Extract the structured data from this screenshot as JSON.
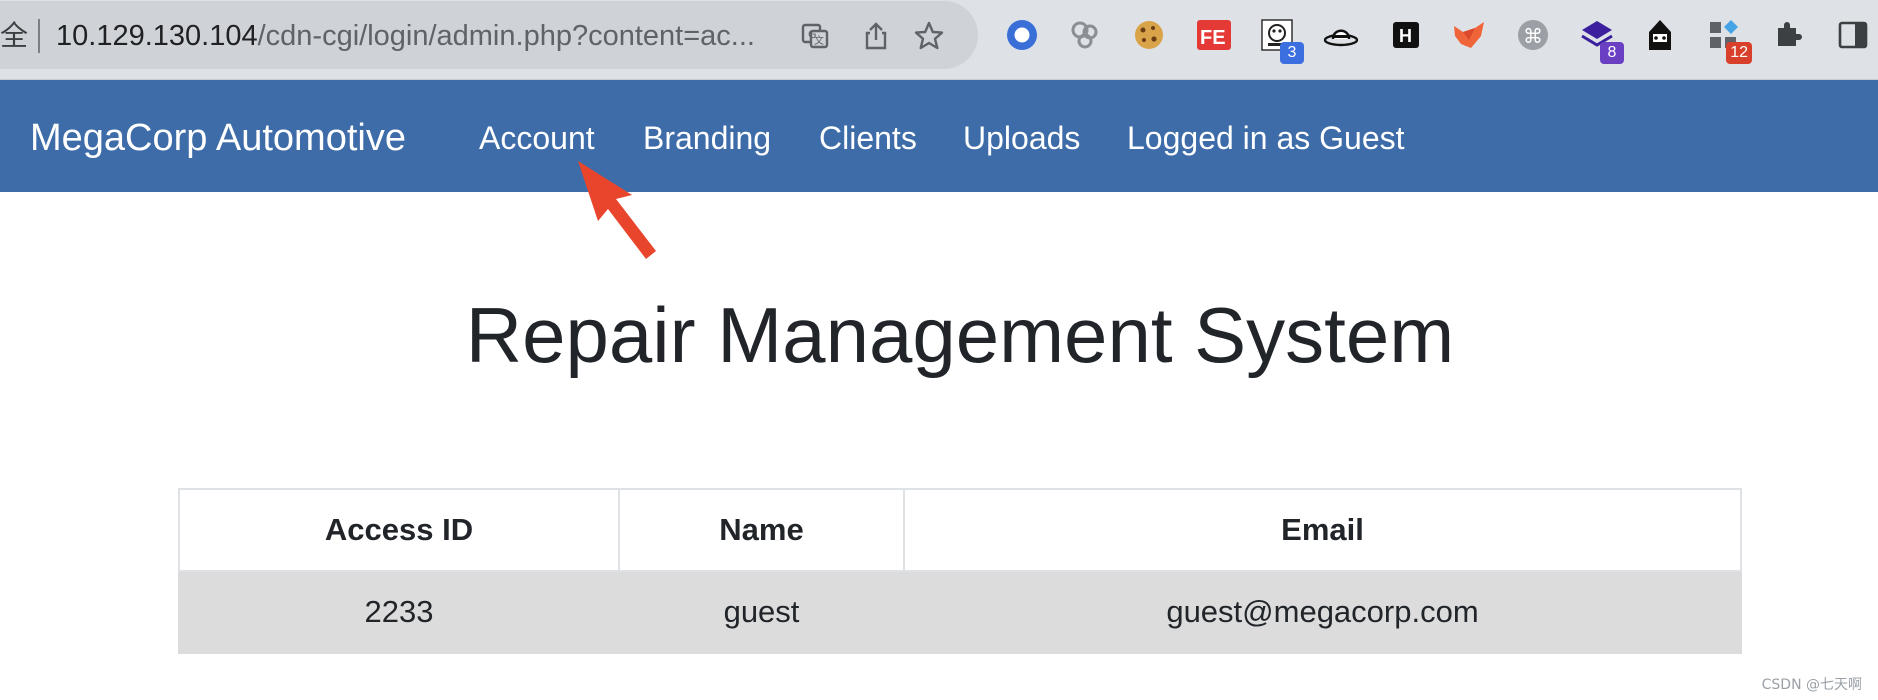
{
  "browser": {
    "security_label": "全",
    "url_host": "10.129.130.104",
    "url_path": "/cdn-cgi/login/admin.php?content=ac...",
    "extensions": [
      {
        "name": "circle-extension-icon",
        "badge": ""
      },
      {
        "name": "cookie-extension-icon",
        "badge": ""
      },
      {
        "name": "fe-extension-icon",
        "badge": ""
      },
      {
        "name": "qr-extension-icon",
        "badge": "3",
        "badge_color": "#3b6fe0"
      },
      {
        "name": "hat-extension-icon",
        "badge": ""
      },
      {
        "name": "h-extension-icon",
        "badge": ""
      },
      {
        "name": "fox-extension-icon",
        "badge": ""
      },
      {
        "name": "command-extension-icon",
        "badge": ""
      },
      {
        "name": "stack-extension-icon",
        "badge": "8",
        "badge_color": "#6a3fc2"
      },
      {
        "name": "hacker-extension-icon",
        "badge": ""
      },
      {
        "name": "apps-extension-icon",
        "badge": "12",
        "badge_color": "#d9402b"
      }
    ]
  },
  "navbar": {
    "brand": "MegaCorp Automotive",
    "links": [
      "Account",
      "Branding",
      "Clients",
      "Uploads",
      "Logged in as Guest"
    ],
    "color": "#3d6ca8"
  },
  "main": {
    "title": "Repair Management System",
    "table": {
      "headers": [
        "Access ID",
        "Name",
        "Email"
      ],
      "rows": [
        [
          "2233",
          "guest",
          "guest@megacorp.com"
        ]
      ]
    }
  },
  "annotation": {
    "arrow_color": "#e8452c"
  },
  "watermark": "CSDN @七天啊"
}
